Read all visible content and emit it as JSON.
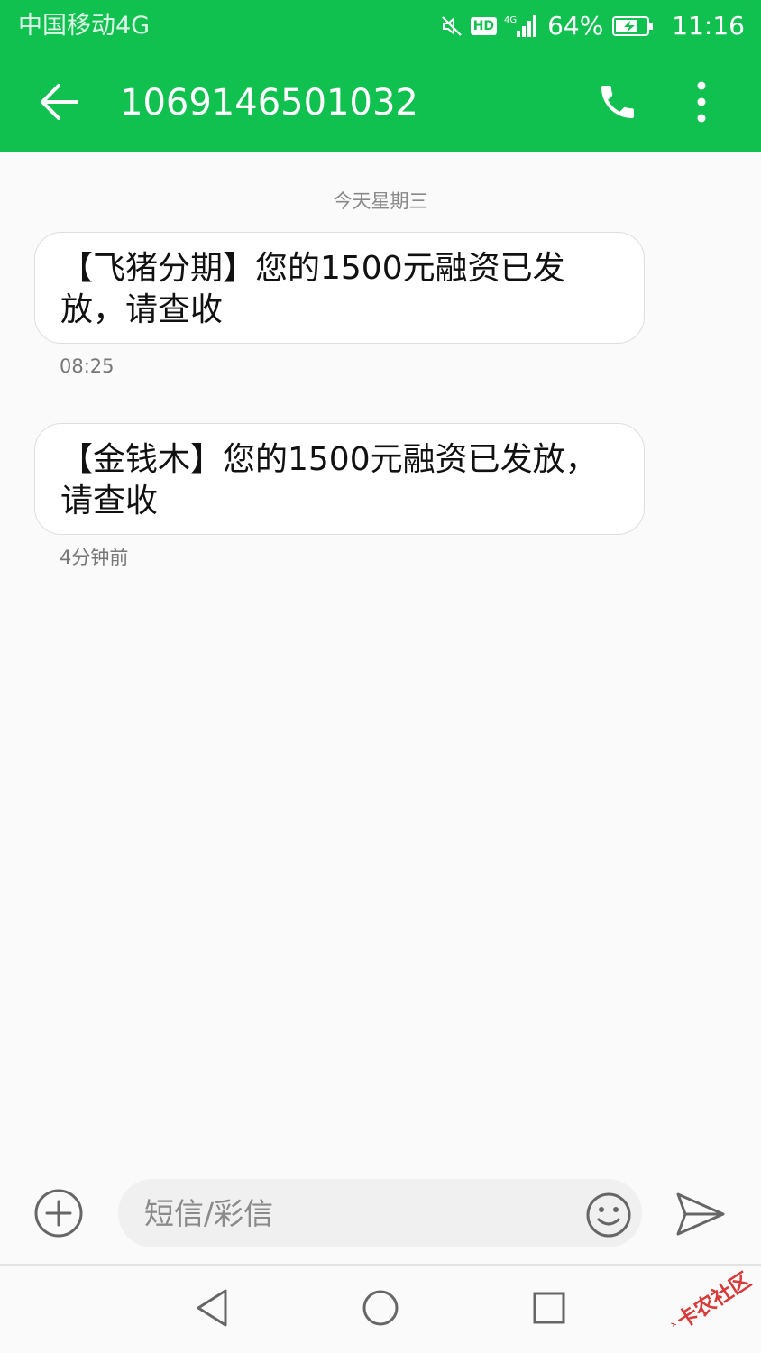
{
  "status_bar": {
    "carrier": "中国移动4G",
    "hd_badge": "HD",
    "battery_percent": "64%",
    "time": "11:16",
    "icons": [
      "mute-icon",
      "hd-icon",
      "signal-4g-icon",
      "battery-charging-icon"
    ]
  },
  "header": {
    "title": "1069146501032",
    "back_icon": "arrow-left-icon",
    "call_icon": "phone-icon",
    "more_icon": "more-vertical-icon"
  },
  "conversation": {
    "date_divider": "今天星期三",
    "messages": [
      {
        "text": "【飞猪分期】您的1500元融资已发放，请查收",
        "time": "08:25"
      },
      {
        "text": "【金钱木】您的1500元融资已发放，请查收",
        "time": "4分钟前"
      }
    ]
  },
  "composer": {
    "placeholder": "短信/彩信",
    "attach_icon": "plus-circle-icon",
    "emoji_icon": "emoji-icon",
    "send_icon": "send-icon"
  },
  "nav_bar": {
    "icons": [
      "nav-back-icon",
      "nav-home-icon",
      "nav-recents-icon"
    ]
  },
  "watermark": {
    "text": "卡农社区"
  },
  "colors": {
    "header_bg": "#10c150",
    "page_bg": "#fafafa",
    "bubble_bg": "#ffffff"
  }
}
